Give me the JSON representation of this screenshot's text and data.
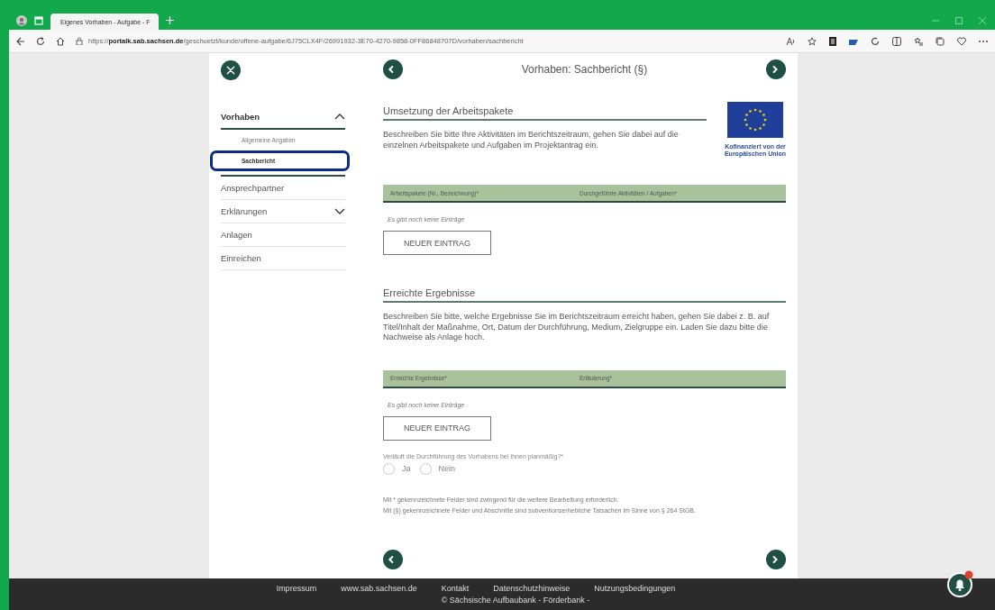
{
  "browser": {
    "tab": {
      "title": "Eigenes Vorhaben - Aufgabe - F",
      "selected": true
    },
    "url": "https://**portalk.sab.sachsen.de**/geschuetzt/kunde/offene-aufgabe/6J75CLX4F/26991932-3E70-4270-9858-0FF86848707D/vorhaben/sachbericht"
  },
  "sidebar": {
    "items": [
      {
        "label": "Vorhaben",
        "kind": "group",
        "expanded": true,
        "children": [
          {
            "label": "Allgemeine Angaben",
            "selected": false
          },
          {
            "label": "Sachbericht",
            "selected": true
          }
        ]
      },
      {
        "label": "Ansprechpartner",
        "kind": "link"
      },
      {
        "label": "Erklärungen",
        "kind": "group",
        "expanded": false
      },
      {
        "label": "Anlagen",
        "kind": "link"
      },
      {
        "label": "Einreichen",
        "kind": "link"
      }
    ]
  },
  "page_title": "Vorhaben: Sachbericht (§)",
  "eu_logo": {
    "caption_1": "Kofinanziert von der",
    "caption_2": "Europäischen Union"
  },
  "sections": [
    {
      "heading": "Umsetzung der Arbeitspakete",
      "description": "Beschreiben Sie bitte Ihre Aktivitäten im Berichtszeitraum, gehen Sie dabei auf die einzelnen Arbeitspakete und Aufgaben im Projektantrag ein.",
      "columns": [
        "Arbeitspakete (Nr., Bezeichnung)*",
        "Durchgeführte Aktivitäten / Aufgaben*"
      ],
      "empty_text": "Es gibt noch keine Einträge",
      "button": "NEUER EINTRAG"
    },
    {
      "heading": "Erreichte Ergebnisse",
      "description": "Beschreiben Sie bitte, welche Ergebnisse Sie im Berichtszeitraum erreicht haben, gehen Sie dabei z. B. auf Titel/Inhalt der Maßnahme, Ort, Datum der Durchführung, Medium, Zielgruppe ein. Laden Sie dazu bitte die Nachweise als Anlage hoch.",
      "columns": [
        "Erreichte Ergebnisse*",
        "Erläuterung*"
      ],
      "empty_text": "Es gibt noch keine Einträge",
      "button": "NEUER EINTRAG"
    }
  ],
  "question": {
    "label": "Verläuft die Durchführung des Vorhabens bei Ihnen planmäßig?*",
    "options": [
      {
        "label": "Ja",
        "selected": false
      },
      {
        "label": "Nein",
        "selected": false
      }
    ]
  },
  "notes": [
    "Mit * gekennzeichnete Felder sind zwingend für die weitere Bearbeitung erforderlich.",
    "Mit (§) gekennzeichnete Felder und Abschnitte sind subventionserhebliche Tatsachen im Sinne von § 264 StGB."
  ],
  "footer": {
    "links": [
      "Impressum",
      "www.sab.sachsen.de",
      "Kontakt",
      "Datenschutzhinweise",
      "Nutzungsbedingungen"
    ],
    "copyright": "© Sächsische Aufbaubank - Förderbank -"
  },
  "notification": {
    "unread": true
  }
}
